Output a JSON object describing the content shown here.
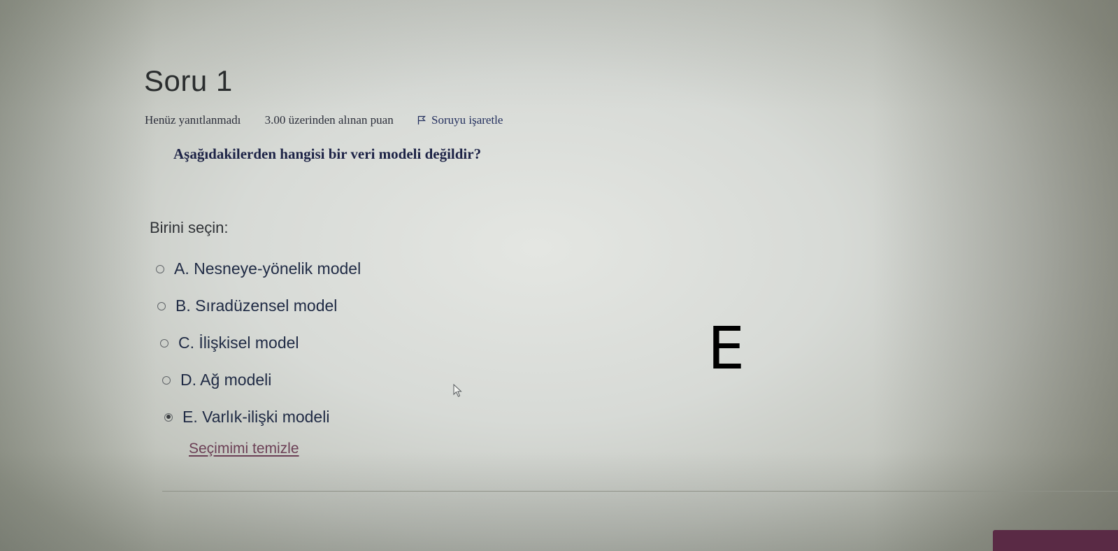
{
  "question": {
    "title": "Soru 1",
    "state": "Henüz yanıtlanmadı",
    "grade": "3.00 üzerinden alınan puan",
    "flag_label": "Soruyu işaretle",
    "flag_icon": "flag-icon",
    "text": "Aşağıdakilerden hangisi bir veri modeli değildir?",
    "prompt": "Birini seçin:",
    "answers": [
      {
        "label": "A. Nesneye-yönelik model",
        "selected": false
      },
      {
        "label": "B. Sıradüzensel model",
        "selected": false
      },
      {
        "label": "C. İlişkisel model",
        "selected": false
      },
      {
        "label": "D. Ağ modeli",
        "selected": false
      },
      {
        "label": "E. Varlık-ilişki modeli",
        "selected": true
      }
    ],
    "clear_label": "Seçimimi temizle"
  },
  "overlay": {
    "answer_letter": "E"
  },
  "colors": {
    "link": "#6b3f55",
    "question_text": "#1d2346",
    "bottom_button": "#5a2a45"
  }
}
